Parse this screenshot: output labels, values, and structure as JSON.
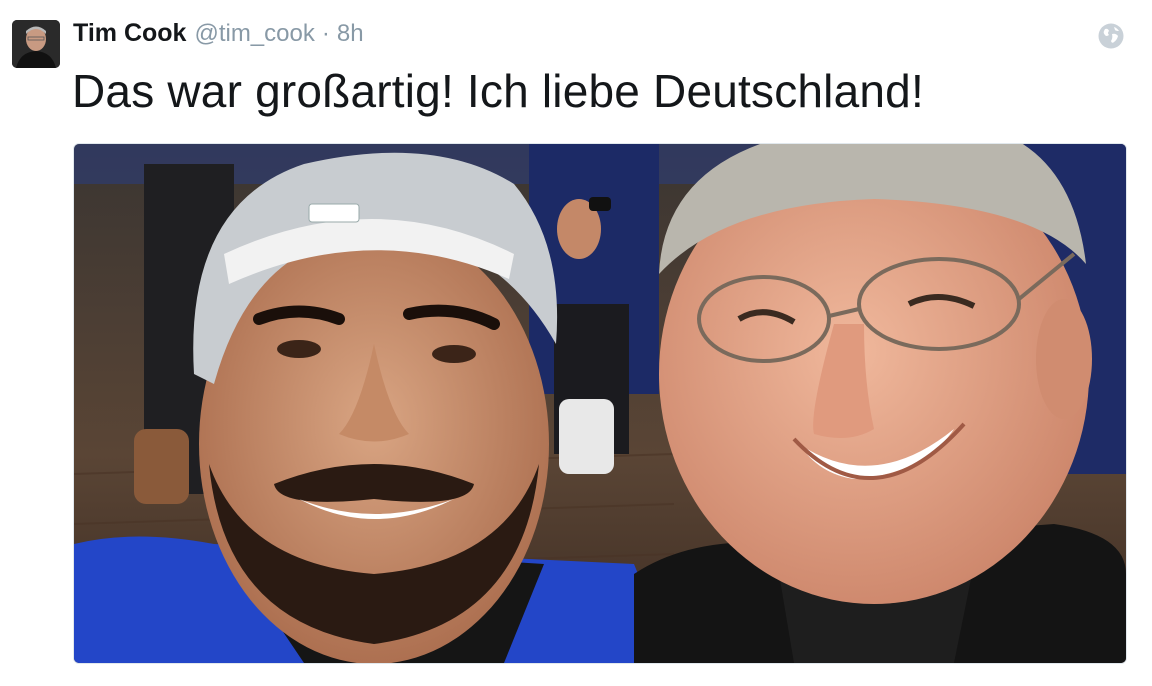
{
  "tweet": {
    "display_name": "Tim Cook",
    "handle": "@tim_cook",
    "separator": "·",
    "time": "8h",
    "text": "Das war großartig! Ich liebe Deutschland!",
    "avatar_icon": "profile-photo",
    "privacy_icon": "globe-icon",
    "media_icon": "selfie-photo"
  },
  "colors": {
    "name": "#14171a",
    "meta": "#8899a6",
    "globe": "#c9d1d8",
    "border": "#e1e8ed"
  }
}
